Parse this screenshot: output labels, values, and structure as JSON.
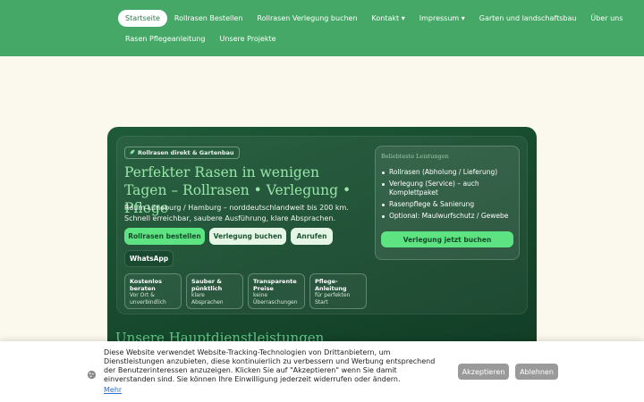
{
  "nav": {
    "row1": [
      "Startseite",
      "Rollrasen Bestellen",
      "Rollrasen Verlegung buchen",
      "Kontakt ▾",
      "Impressum ▾",
      "Garten und landschaftsbau",
      "Über uns"
    ],
    "row2": [
      "Rasen Pflegeanleitung",
      "Unsere Projekte"
    ],
    "active_index": 0
  },
  "hero": {
    "badge": "Rollrasen direkt & Gartenbau",
    "title": "Perfekter Rasen in wenigen Tagen – Rollrasen • Verlegung • Pflege",
    "subtitle": "Raum Lüneburg / Hamburg – norddeutschlandweit bis 200 km. Schnell erreichbar, saubere Ausführung, klare Absprachen.",
    "buttons": {
      "order": "Rollrasen bestellen",
      "book": "Verlegung buchen",
      "call": "Anrufen",
      "whatsapp": "WhatsApp"
    },
    "features": [
      {
        "title": "Kostenlos beraten",
        "desc": "Vor Ort & unverbindlich"
      },
      {
        "title": "Sauber & pünktlich",
        "desc": "klare Absprachen"
      },
      {
        "title": "Transparente Preise",
        "desc": "keine Überraschungen"
      },
      {
        "title": "Pflege-Anleitung",
        "desc": "für perfekten Start"
      }
    ]
  },
  "panel": {
    "title": "Beliebteste Leistungen",
    "items": [
      "Rollrasen (Abholung / Lieferung)",
      "Verlegung (Service) – auch Komplettpaket",
      "Rasenpflege & Sanierung",
      "Optional: Maulwurfschutz / Gewebe"
    ],
    "cta": "Verlegung jetzt buchen"
  },
  "section": {
    "heading": "Unsere Hauptdienstleistungen"
  },
  "cookie": {
    "text": "Diese Website verwendet Website-Tracking-Technologien von Drittanbietern, um Dienstleistungen anzubieten, diese kontinuierlich zu verbessern und Werbung entsprechend der Benutzerinteressen anzuzeigen. Klicken Sie auf \"Akzeptieren\" wenn Sie damit einverstanden sind. Sie können Ihre Einwilligung jederzeit widerrufen oder ändern.",
    "more": "Mehr",
    "accept": "Akzeptieren",
    "reject": "Ablehnen"
  },
  "colors": {
    "nav_bg": "#46a866",
    "hero_bg": "#174a2e",
    "accent_green": "#5de381",
    "page_bg": "#fbf8ee"
  }
}
